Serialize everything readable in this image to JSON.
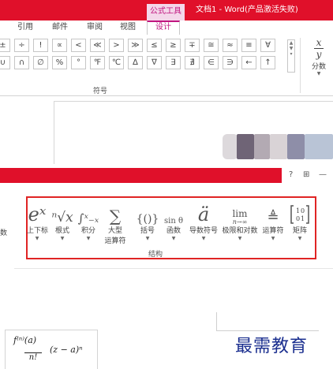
{
  "titlebar": {
    "context_tab": "公式工具",
    "document_title": "文档1 - Word(产品激活失败)"
  },
  "tabs": [
    {
      "label": "引用"
    },
    {
      "label": "邮件"
    },
    {
      "label": "审阅"
    },
    {
      "label": "视图"
    },
    {
      "label": "设计"
    }
  ],
  "symbols": {
    "row1": [
      "±",
      "÷",
      "!",
      "∝",
      "<",
      "≪",
      ">",
      "≫",
      "≤",
      "≥",
      "∓",
      "≅",
      "≈",
      "≡",
      "∀"
    ],
    "row2": [
      "∪",
      "∩",
      "∅",
      "%",
      "°",
      "℉",
      "℃",
      "∆",
      "∇",
      "∃",
      "∄",
      "∈",
      "∋",
      "←",
      "↑"
    ],
    "group_label": "符号",
    "fraction_label": "分数",
    "fraction_num": "x",
    "fraction_den": "y"
  },
  "window_controls": {
    "help": "?",
    "restore": "⊞",
    "minimize": "—"
  },
  "structures": {
    "edge_label": "数",
    "group_label": "结构",
    "buttons": [
      {
        "glyph": "eˣ",
        "label": "上下标"
      },
      {
        "glyph": "ⁿ√x",
        "label": "根式"
      },
      {
        "glyph": "∫ˣ₋ₓ",
        "label": "积分"
      },
      {
        "glyph": "∑",
        "label": "大型",
        "label2": "运算符"
      },
      {
        "glyph": "{()}",
        "label": "括号"
      },
      {
        "glyph": "sin θ",
        "label": "函数"
      },
      {
        "glyph": "ä",
        "label": "导数符号"
      },
      {
        "glyph": "lim",
        "sub": "n→∞",
        "label": "极限和对数"
      },
      {
        "glyph": "≜",
        "label": "运算符"
      },
      {
        "glyph": "[1 0; 0 1]",
        "label": "矩阵"
      }
    ]
  },
  "equation": {
    "numerator": "f⁽ⁿ⁾(a)",
    "denominator": "n!",
    "tail": "(z − a)ⁿ"
  },
  "watermark": "最需教育",
  "colors": {
    "red_bar": "#e0102a",
    "accent_magenta": "#c01680",
    "highlight_box": "#e02424",
    "watermark": "#1b2f8f"
  }
}
